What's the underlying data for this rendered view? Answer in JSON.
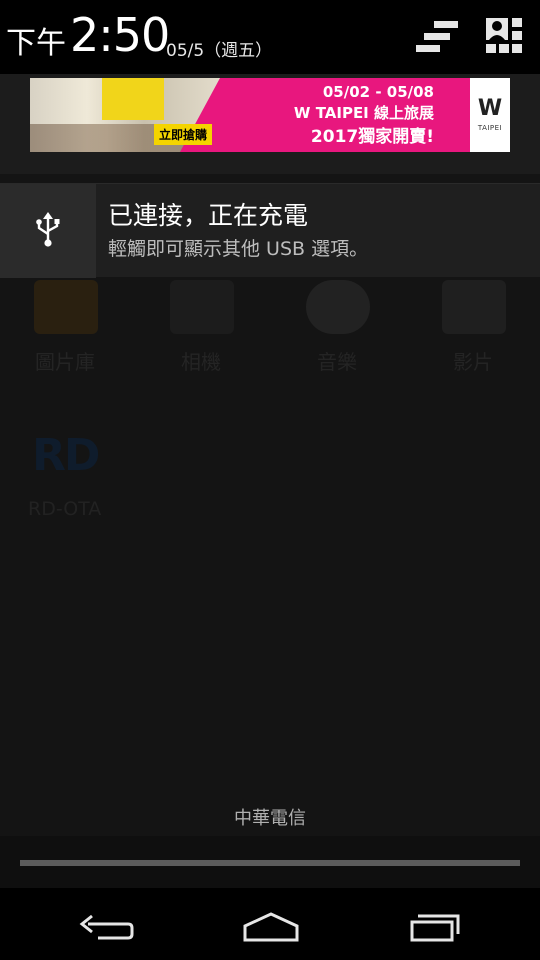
{
  "status_header": {
    "ampm": "下午",
    "time": "2:50",
    "date": "05/5（週五）",
    "icons": [
      "sort-notifications-icon",
      "quick-settings-icon"
    ]
  },
  "ad": {
    "cta": "立即搶購",
    "date_range": "05/02 - 05/08",
    "headline": "W TAIPEI 線上旅展",
    "subheadline": "2017獨家開賣!",
    "logo_mark": "W",
    "logo_text": "TAIPEI"
  },
  "notification": {
    "icon": "usb-icon",
    "title": "已連接，正在充電",
    "text": "輕觸即可顯示其他 USB 選項。"
  },
  "background_apps": [
    {
      "label": "圖片庫",
      "color": "#2a2010"
    },
    {
      "label": "相機",
      "color": "#1c1c1c"
    },
    {
      "label": "音樂",
      "color": "#222222"
    },
    {
      "label": "影片",
      "color": "#1f1f1f"
    }
  ],
  "background_shortcut": {
    "logo": "RD",
    "label": "RD-OTA"
  },
  "carrier": "中華電信",
  "navbar": [
    "back-icon",
    "home-icon",
    "recent-apps-icon"
  ],
  "colors": {
    "ad_magenta": "#e8177e",
    "ad_yellow": "#f4d400",
    "panel": "#1f1f1f",
    "background": "#141414"
  }
}
